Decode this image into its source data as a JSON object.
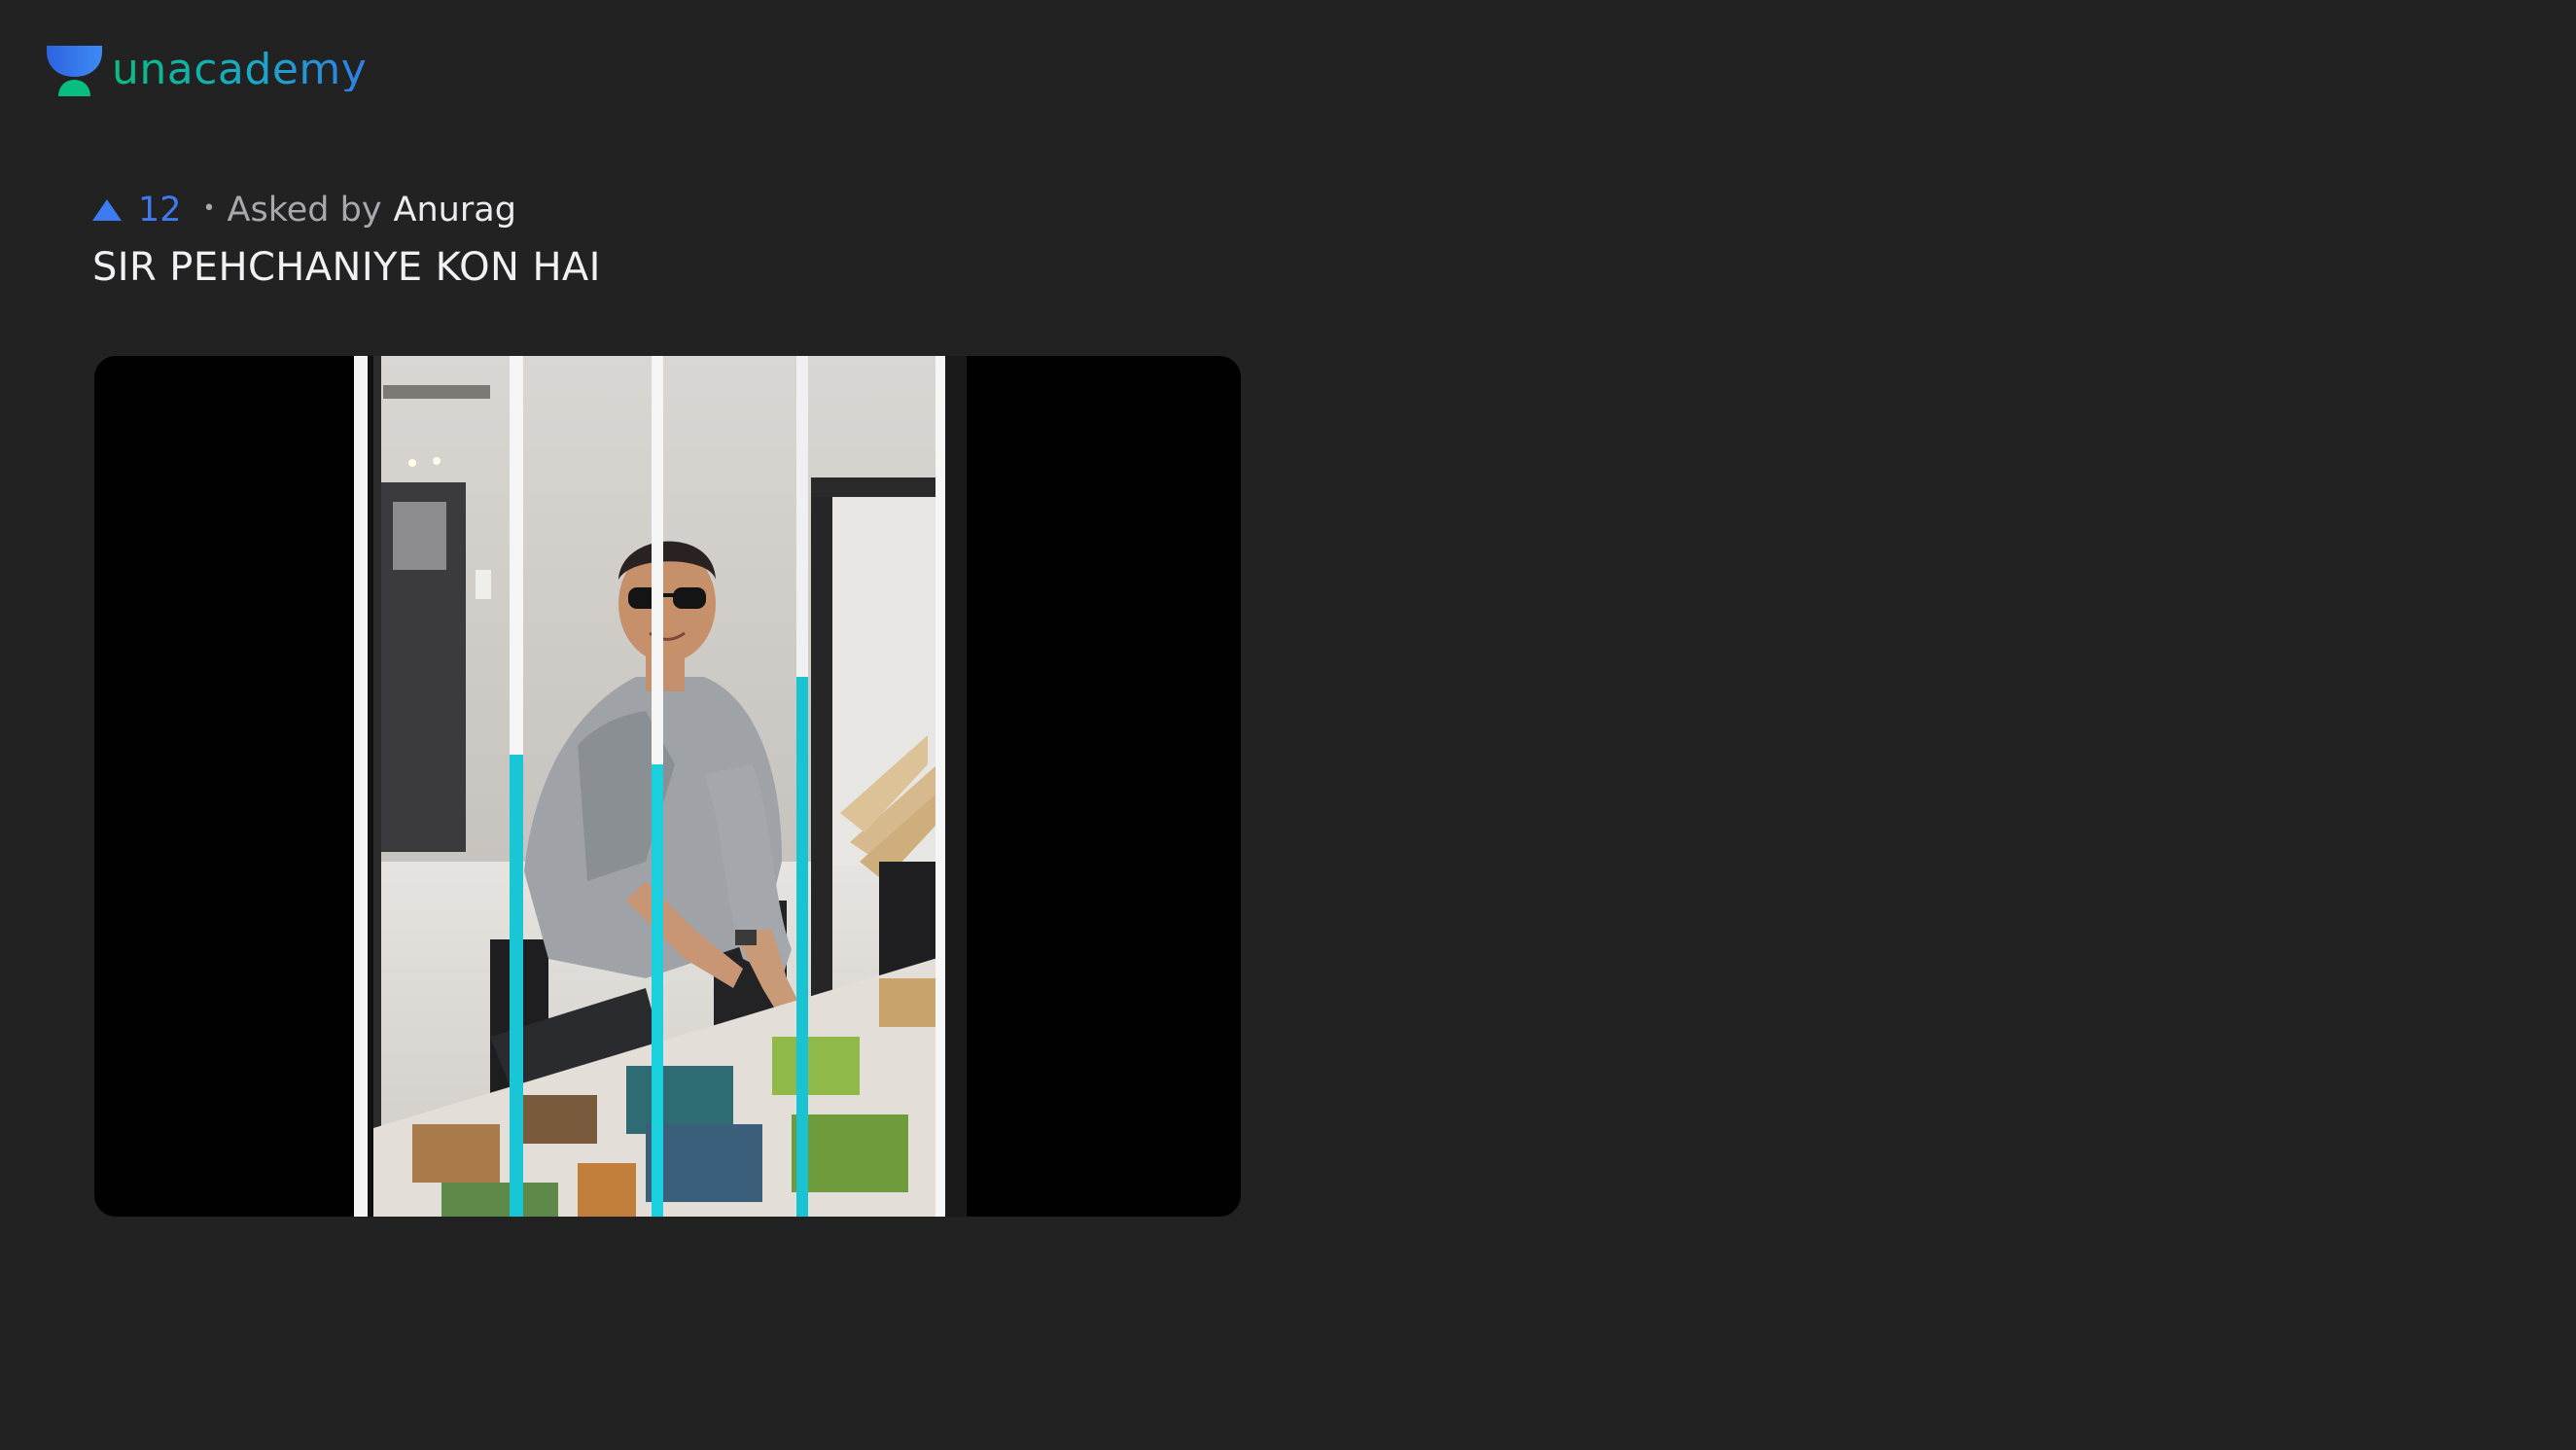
{
  "brand": {
    "name": "unacademy"
  },
  "question": {
    "upvotes": "12",
    "bullet": "•",
    "asked_by_label": "Asked by",
    "author": "Anurag",
    "text": "SIR PEHCHANIYE KON HAI"
  },
  "colors": {
    "background": "#222223",
    "accent_blue": "#3c7bf0",
    "brand_green": "#08bd80"
  },
  "icons": {
    "logo": "unacademy-logo-icon",
    "upvote": "upvote-triangle-icon"
  }
}
